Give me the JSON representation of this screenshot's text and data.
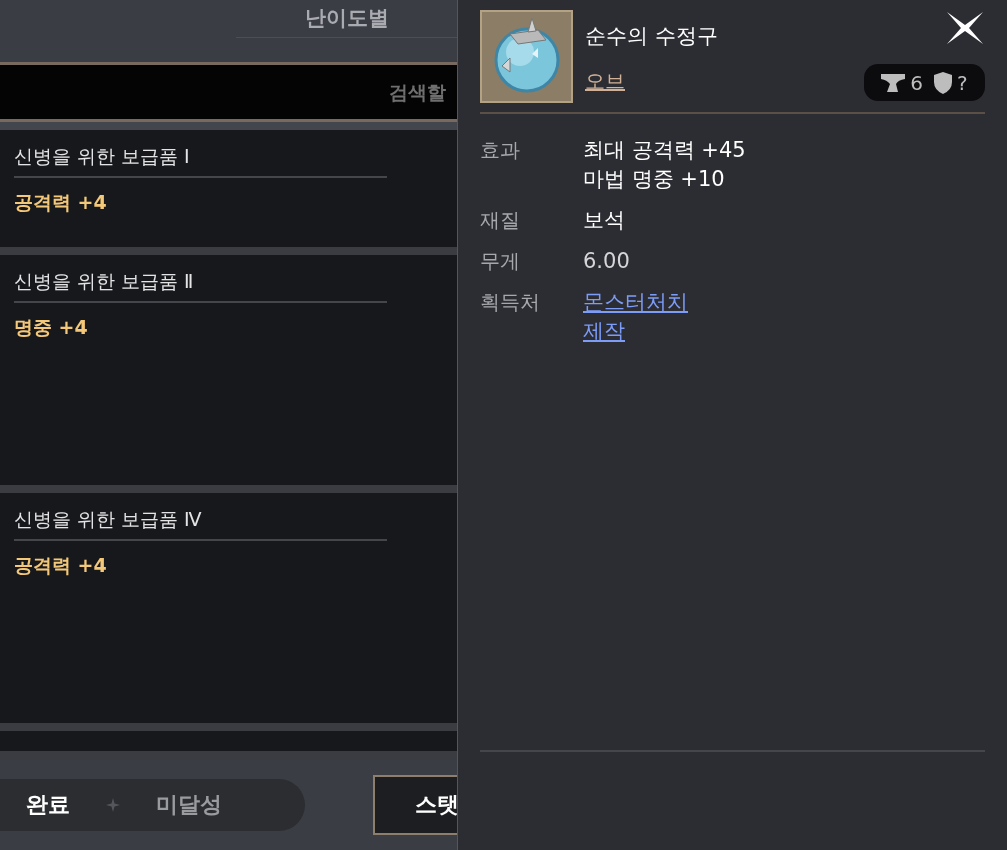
{
  "header": {
    "tab": "난이도별"
  },
  "search": {
    "placeholder": "검색할"
  },
  "quests": [
    {
      "title": "신병을 위한 보급품 Ⅰ",
      "reward": "공격력 +4"
    },
    {
      "title": "신병을 위한 보급품 Ⅱ",
      "reward": "명중 +4"
    },
    {
      "title": "신병을 위한 보급품 Ⅳ",
      "reward": "공격력 +4"
    }
  ],
  "filter": [
    {
      "label": "완료",
      "selected": true
    },
    {
      "label": "미달성",
      "selected": false
    }
  ],
  "stat_search_button": "스탯",
  "tooltip": {
    "name": "순수의 수정구",
    "type": "오브",
    "badge": {
      "enhance": "6",
      "defense": "?"
    },
    "rows": [
      {
        "label": "효과",
        "kind": "text",
        "values": [
          "최대 공격력 +45",
          "마법 명중 +10"
        ]
      },
      {
        "label": "재질",
        "kind": "text",
        "values": [
          "보석"
        ]
      },
      {
        "label": "무게",
        "kind": "text",
        "values": [
          "6.00"
        ]
      },
      {
        "label": "획득처",
        "kind": "link",
        "values": [
          "몬스터처치",
          "제작"
        ]
      }
    ]
  }
}
